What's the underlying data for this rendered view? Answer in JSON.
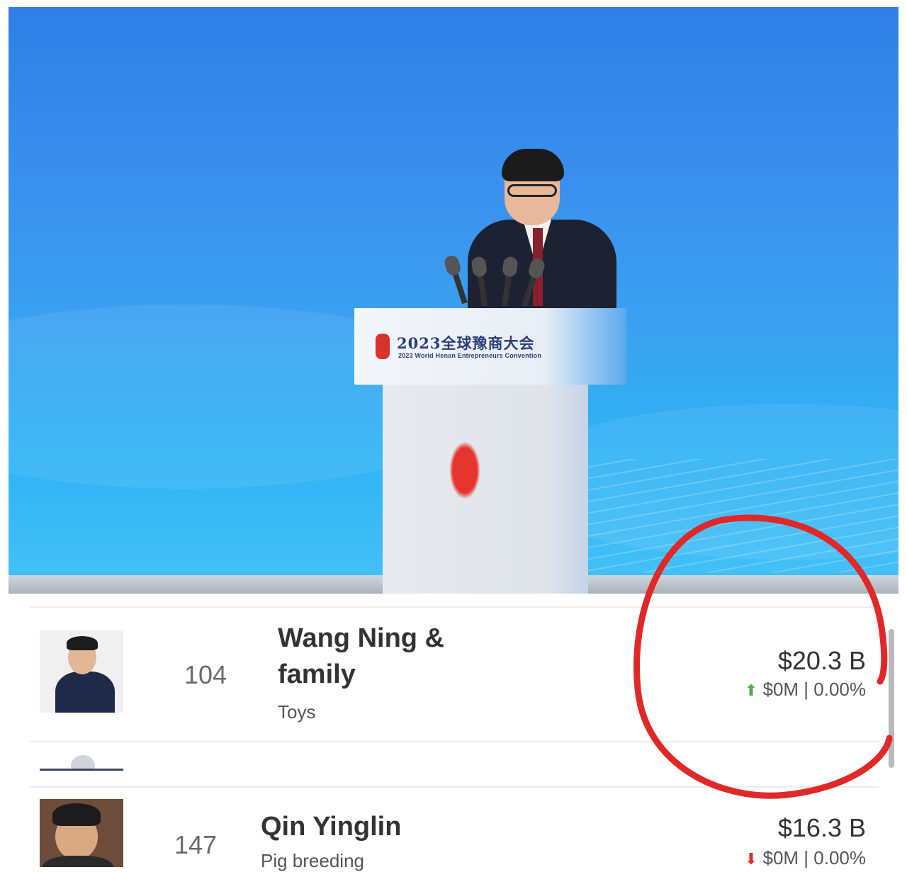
{
  "photo": {
    "podium_title": "2023全球豫商大会",
    "podium_subtitle": "2023 World Henan Entrepreneurs Convention"
  },
  "list": {
    "rows": [
      {
        "rank": "104",
        "name_line1": "Wang Ning &",
        "name_line2": "family",
        "industry": "Toys",
        "net_worth": "$20.3 B",
        "change": "$0M | 0.00%",
        "change_direction": "up",
        "change_icon": "arrow-up-icon"
      },
      {
        "rank": "147",
        "name_line1": "Qin Yinglin",
        "industry": "Pig breeding",
        "net_worth": "$16.3 B",
        "change": "$0M | 0.00%",
        "change_direction": "down",
        "change_icon": "arrow-down-icon"
      }
    ]
  },
  "colors": {
    "up": "#4caf50",
    "down": "#d0342c",
    "annotation": "#e02828"
  }
}
